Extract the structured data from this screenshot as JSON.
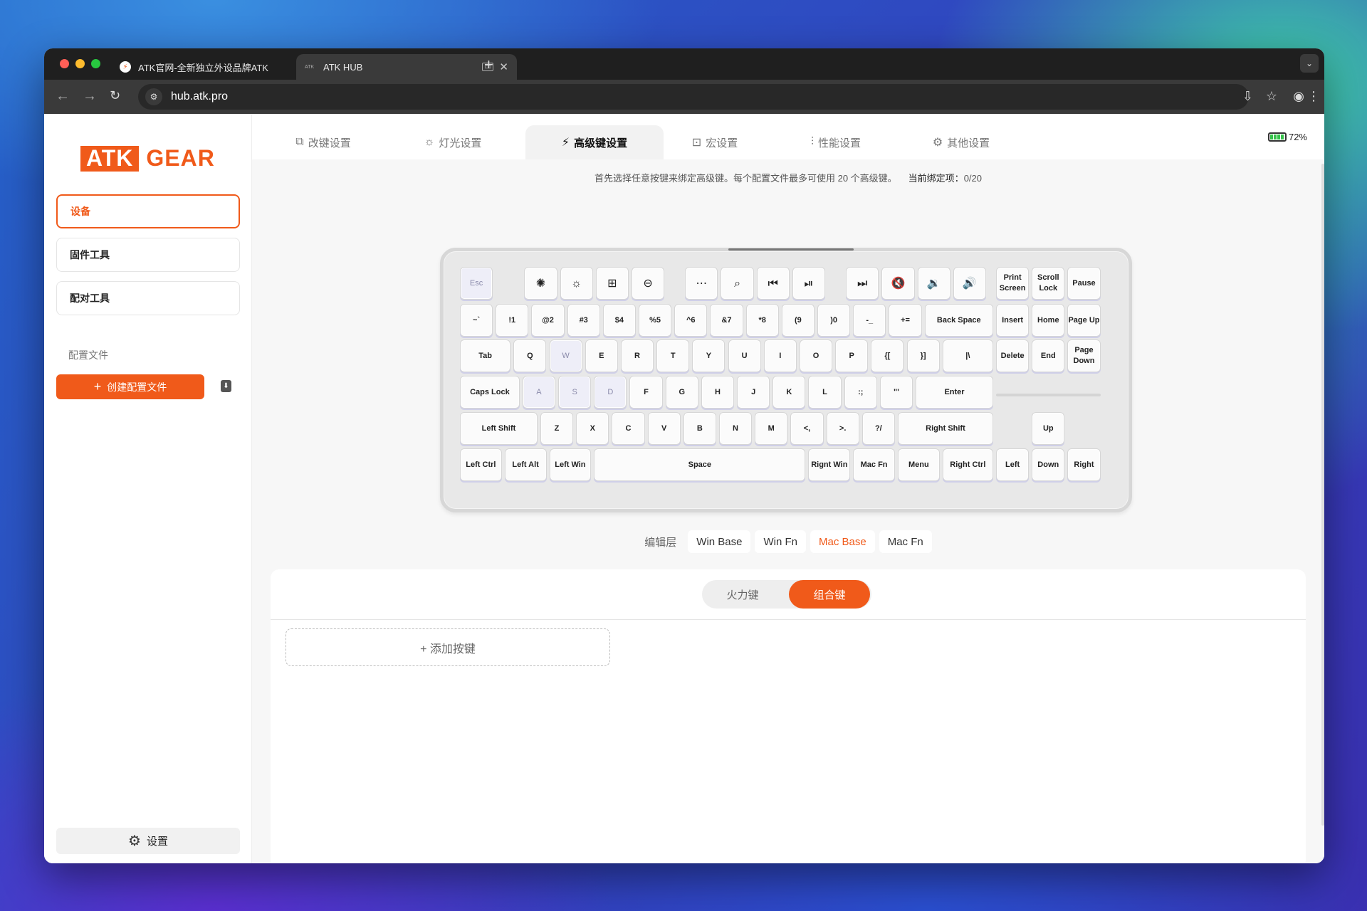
{
  "browser": {
    "tabs": [
      {
        "title": "ATK官网-全新独立外设品牌ATK",
        "icon": "atk-favicon"
      },
      {
        "title": "ATK HUB",
        "icon": "atk-hub-favicon"
      }
    ],
    "url": "hub.atk.pro"
  },
  "sidebar": {
    "logo_left": "ATK",
    "logo_right": "GEAR",
    "items": [
      {
        "label": "设备"
      },
      {
        "label": "固件工具"
      },
      {
        "label": "配对工具"
      }
    ],
    "profiles_title": "配置文件",
    "create_label": "创建配置文件",
    "settings_label": "设置"
  },
  "topnav": {
    "tabs": [
      {
        "label": "改键设置",
        "icon": "remap-icon"
      },
      {
        "label": "灯光设置",
        "icon": "light-icon"
      },
      {
        "label": "高级键设置",
        "icon": "advanced-key-icon"
      },
      {
        "label": "宏设置",
        "icon": "macro-icon"
      },
      {
        "label": "性能设置",
        "icon": "performance-icon"
      },
      {
        "label": "其他设置",
        "icon": "other-settings-icon"
      }
    ],
    "active_tab": "高级键设置",
    "battery": "72%"
  },
  "hint": {
    "text": "首先选择任意按键来绑定高级键。每个配置文件最多可使用 20 个高级键。",
    "bound_label": "当前绑定项：",
    "bound_value": "0/20"
  },
  "keyboard": {
    "row0": [
      "Esc",
      "✺",
      "☼",
      "⊞",
      "⊖",
      "⋯",
      "⌕",
      "⏮",
      "⏯",
      "⏭",
      "🔇",
      "🔉",
      "🔊",
      "Print Screen",
      "Scroll Lock",
      "Pause"
    ],
    "row1": [
      "~`",
      "!1",
      "@2",
      "#3",
      "$4",
      "%5",
      "^6",
      "&7",
      "*8",
      "(9",
      ")0",
      "-_",
      "+=",
      "Back Space",
      "Insert",
      "Home",
      "Page Up"
    ],
    "row2": [
      "Tab",
      "Q",
      "W",
      "E",
      "R",
      "T",
      "Y",
      "U",
      "I",
      "O",
      "P",
      "{[",
      "}]",
      "|\\",
      "Delete",
      "End",
      "Page Down"
    ],
    "row3": [
      "Caps Lock",
      "A",
      "S",
      "D",
      "F",
      "G",
      "H",
      "J",
      "K",
      "L",
      ":;",
      "\"'",
      "Enter"
    ],
    "row4": [
      "Left Shift",
      "Z",
      "X",
      "C",
      "V",
      "B",
      "N",
      "M",
      "<,",
      ">.",
      "?/",
      "Right Shift",
      "Up"
    ],
    "row5": [
      "Left Ctrl",
      "Left Alt",
      "Left Win",
      "Space",
      "Rignt Win",
      "Mac Fn",
      "Menu",
      "Right Ctrl",
      "Left",
      "Down",
      "Right"
    ]
  },
  "layers": {
    "label": "编辑层",
    "items": [
      "Win Base",
      "Win Fn",
      "Mac Base",
      "Mac Fn"
    ],
    "active": "Mac Base"
  },
  "panel": {
    "toggle": [
      "火力键",
      "组合键"
    ],
    "active": "组合键",
    "add_label": "+ 添加按键"
  },
  "colors": {
    "accent": "#f05a1a",
    "battery": "#35c24a"
  }
}
